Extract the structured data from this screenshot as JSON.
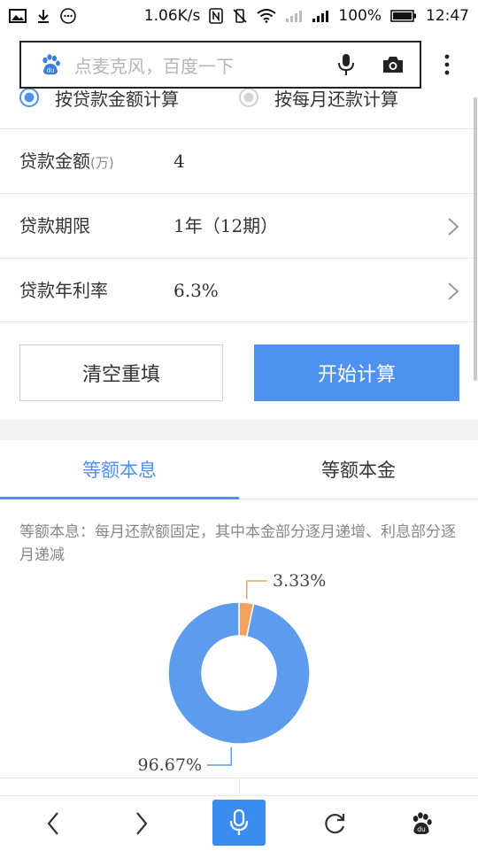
{
  "status_bar": {
    "network_speed": "1.06K/s",
    "battery": "100%",
    "time": "12:47"
  },
  "search": {
    "placeholder": "点麦克风，百度一下"
  },
  "calc_mode": {
    "option1": "按贷款金额计算",
    "option2": "按每月还款计算"
  },
  "form": {
    "amount_label": "贷款金额",
    "amount_unit": "(万)",
    "amount_value": "4",
    "term_label": "贷款期限",
    "term_value": "1年（12期）",
    "rate_label": "贷款年利率",
    "rate_value": "6.3%"
  },
  "buttons": {
    "clear": "清空重填",
    "calculate": "开始计算"
  },
  "tabs": {
    "equal_installment": "等额本息",
    "equal_principal": "等额本金"
  },
  "description": "等额本息：每月还款额固定，其中本金部分逐月递增、利息部分逐月递减",
  "chart_data": {
    "type": "pie",
    "style": "donut",
    "slices": [
      {
        "label": "3.33%",
        "value": 3.33,
        "color": "#f2a15f"
      },
      {
        "label": "96.67%",
        "value": 96.67,
        "color": "#5d9bec"
      }
    ]
  },
  "colors": {
    "accent": "#4e91ee",
    "principal": "#5d9bec",
    "interest": "#f2a15f"
  }
}
